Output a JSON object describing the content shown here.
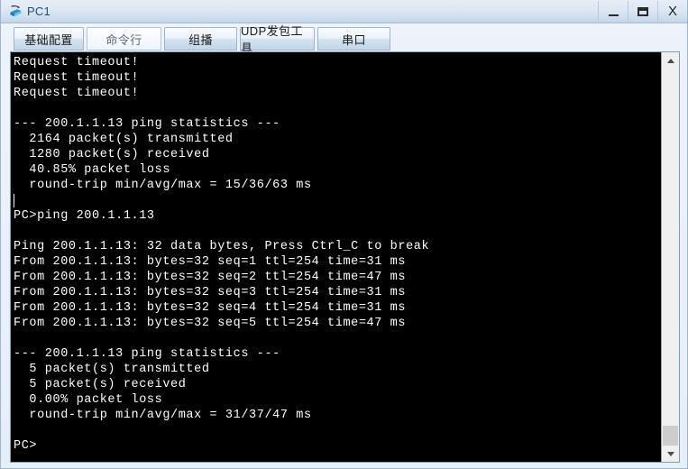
{
  "window": {
    "title": "PC1",
    "icon": "pc-device-icon",
    "controls": [
      {
        "name": "minimize-button",
        "label": "–",
        "glyph": "minimize-icon"
      },
      {
        "name": "maximize-button",
        "label": "□",
        "glyph": "maximize-icon"
      },
      {
        "name": "close-button",
        "label": "X",
        "glyph": "close-icon"
      }
    ]
  },
  "tabs": [
    {
      "label": "基础配置",
      "active": false
    },
    {
      "label": "命令行",
      "active": true
    },
    {
      "label": "组播",
      "active": false
    },
    {
      "label": "UDP发包工具",
      "active": false
    },
    {
      "label": "串口",
      "active": false
    }
  ],
  "terminal": {
    "prompt": "PC>",
    "command": "ping 200.1.1.13",
    "target_host": "200.1.1.13",
    "lines": [
      {
        "text": "Request timeout!",
        "cursor": false
      },
      {
        "text": "Request timeout!",
        "cursor": false
      },
      {
        "text": "Request timeout!",
        "cursor": false
      },
      {
        "text": "",
        "cursor": false
      },
      {
        "text": "--- 200.1.1.13 ping statistics ---",
        "cursor": false
      },
      {
        "text": "  2164 packet(s) transmitted",
        "cursor": false
      },
      {
        "text": "  1280 packet(s) received",
        "cursor": false
      },
      {
        "text": "  40.85% packet loss",
        "cursor": false
      },
      {
        "text": "  round-trip min/avg/max = 15/36/63 ms",
        "cursor": false
      },
      {
        "text": "",
        "cursor": true
      },
      {
        "text": "PC>ping 200.1.1.13",
        "cursor": false
      },
      {
        "text": "",
        "cursor": false
      },
      {
        "text": "Ping 200.1.1.13: 32 data bytes, Press Ctrl_C to break",
        "cursor": false
      },
      {
        "text": "From 200.1.1.13: bytes=32 seq=1 ttl=254 time=31 ms",
        "cursor": false
      },
      {
        "text": "From 200.1.1.13: bytes=32 seq=2 ttl=254 time=47 ms",
        "cursor": false
      },
      {
        "text": "From 200.1.1.13: bytes=32 seq=3 ttl=254 time=31 ms",
        "cursor": false
      },
      {
        "text": "From 200.1.1.13: bytes=32 seq=4 ttl=254 time=31 ms",
        "cursor": false
      },
      {
        "text": "From 200.1.1.13: bytes=32 seq=5 ttl=254 time=47 ms",
        "cursor": false
      },
      {
        "text": "",
        "cursor": false
      },
      {
        "text": "--- 200.1.1.13 ping statistics ---",
        "cursor": false
      },
      {
        "text": "  5 packet(s) transmitted",
        "cursor": false
      },
      {
        "text": "  5 packet(s) received",
        "cursor": false
      },
      {
        "text": "  0.00% packet loss",
        "cursor": false
      },
      {
        "text": "  round-trip min/avg/max = 31/37/47 ms",
        "cursor": false
      },
      {
        "text": "",
        "cursor": false
      },
      {
        "text": "PC>",
        "cursor": false
      }
    ],
    "first_ping_stats": {
      "host": "200.1.1.13",
      "transmitted": 2164,
      "received": 1280,
      "packet_loss": "40.85%",
      "min_ms": 15,
      "avg_ms": 36,
      "max_ms": 63
    },
    "second_ping_stats": {
      "host": "200.1.1.13",
      "data_bytes": 32,
      "transmitted": 5,
      "received": 5,
      "packet_loss": "0.00%",
      "min_ms": 31,
      "avg_ms": 37,
      "max_ms": 47,
      "replies": [
        {
          "seq": 1,
          "bytes": 32,
          "ttl": 254,
          "time_ms": 31
        },
        {
          "seq": 2,
          "bytes": 32,
          "ttl": 254,
          "time_ms": 47
        },
        {
          "seq": 3,
          "bytes": 32,
          "ttl": 254,
          "time_ms": 31
        },
        {
          "seq": 4,
          "bytes": 32,
          "ttl": 254,
          "time_ms": 31
        },
        {
          "seq": 5,
          "bytes": 32,
          "ttl": 254,
          "time_ms": 47
        }
      ]
    }
  },
  "scrollbar": {
    "up_arrow": "chevron-up-icon",
    "down_arrow": "chevron-down-icon",
    "thumb_position_percent": 95
  },
  "colors": {
    "titlebar_top": "#e7eef7",
    "titlebar_bottom": "#b9cee3",
    "title_text": "#1d4e80",
    "terminal_bg": "#000000",
    "terminal_fg": "#ffffff",
    "tab_border": "#9eb4c9",
    "window_bg": "#eaf0fa"
  }
}
